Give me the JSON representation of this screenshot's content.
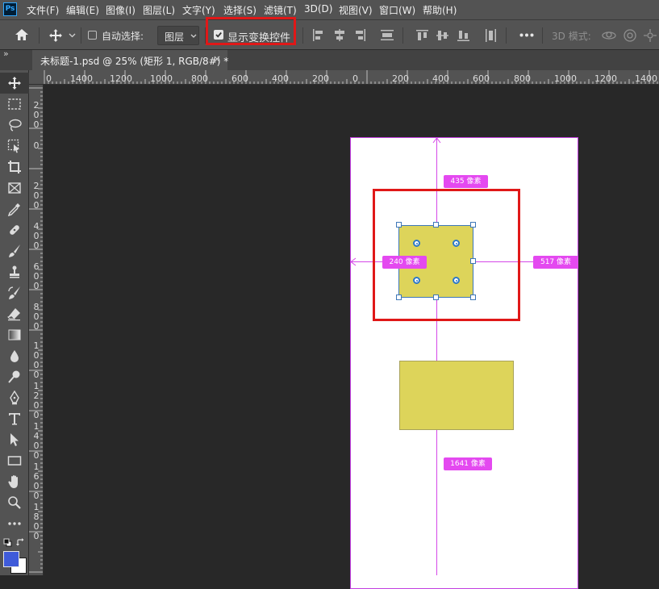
{
  "app": {
    "logo": "Ps"
  },
  "menu": [
    "文件(F)",
    "编辑(E)",
    "图像(I)",
    "图层(L)",
    "文字(Y)",
    "选择(S)",
    "滤镜(T)",
    "3D(D)",
    "视图(V)",
    "窗口(W)",
    "帮助(H)"
  ],
  "options_bar": {
    "auto_select_label": "自动选择:",
    "auto_select_checked": false,
    "auto_select_target": "图层",
    "show_transform_label": "显示变换控件",
    "show_transform_checked": true,
    "mode_3d_label": "3D 模式:",
    "more_icon": "more-icon"
  },
  "tab": {
    "title": "未标题-1.psd @ 25% (矩形 1, RGB/8#) *",
    "close": "×"
  },
  "panel_collapse": "»",
  "ruler_top": [
    "0",
    "1400",
    "1200",
    "1000",
    "800",
    "600",
    "400",
    "200",
    "0",
    "200",
    "400",
    "600",
    "800",
    "1000",
    "1200",
    "1400"
  ],
  "ruler_left": [
    "2\n0\n0",
    "0",
    "2\n0\n0",
    "4\n0\n0",
    "6\n0\n0",
    "8\n0\n0",
    "1\n0\n0\n0",
    "1\n2\n0\n0",
    "1\n4\n0\n0",
    "1\n6\n0\n0",
    "1\n8\n0\n0"
  ],
  "canvas": {
    "measurements": {
      "top": "435 像素",
      "left": "240 像素",
      "right": "517 像素",
      "bottom": "1641 像素"
    },
    "shape_color": "#ddd45a",
    "guide_color": "#d548e8",
    "highlight_color": "#e01818"
  },
  "colors": {
    "foreground": "#3f5bd9",
    "background": "#ffffff"
  }
}
